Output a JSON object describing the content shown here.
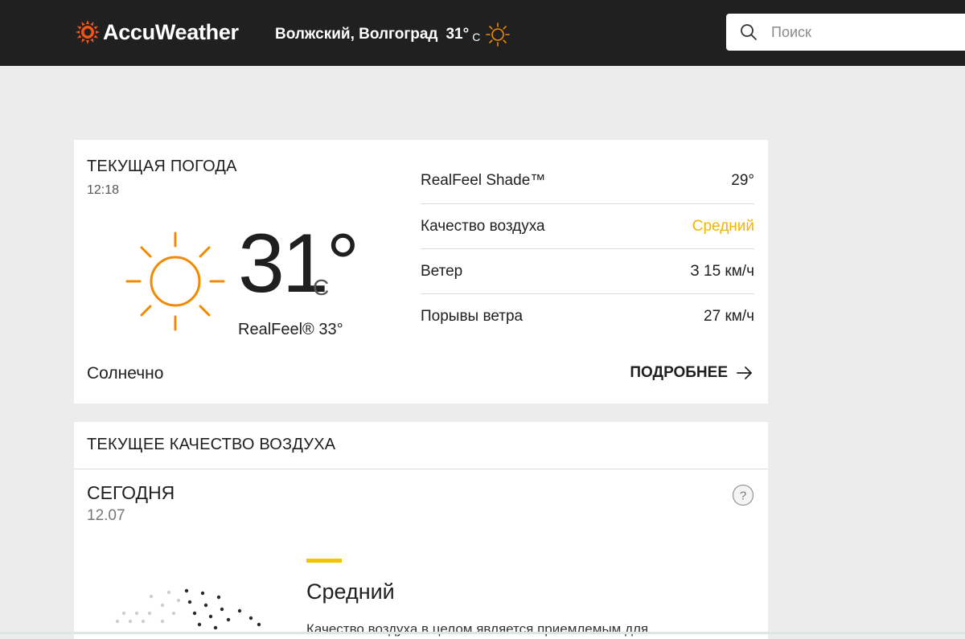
{
  "header": {
    "brand": "AccuWeather",
    "location": "Волжский, Волгоград",
    "temp": "31°",
    "unit": "C",
    "weather_icon": "sun-icon",
    "search_placeholder": "Поиск",
    "search_icon": "search-icon"
  },
  "current": {
    "title": "ТЕКУЩАЯ ПОГОДА",
    "time": "12:18",
    "icon": "sun-icon",
    "temp": "31°",
    "unit": "C",
    "realfeel": "RealFeel® 33°",
    "phrase": "Солнечно",
    "more_label": "ПОДРОБНЕЕ",
    "details": [
      {
        "label": "RealFeel Shade™",
        "value": "29°"
      },
      {
        "label": "Качество воздуха",
        "value": "Средний"
      },
      {
        "label": "Ветер",
        "value": "З 15 км/ч"
      },
      {
        "label": "Порывы ветра",
        "value": "27 км/ч"
      }
    ]
  },
  "air_quality": {
    "title": "ТЕКУЩЕЕ КАЧЕСТВО ВОЗДУХА",
    "day": "СЕГОДНЯ",
    "date": "12.07",
    "level": "Средний",
    "description": "Качество воздуха в целом является приемлемым для"
  },
  "colors": {
    "header_bg": "#202020",
    "brand_orange": "#f05514",
    "sun_orange": "#f28a00",
    "aq_yellow": "#f5b400",
    "page_bg": "#ececec"
  }
}
